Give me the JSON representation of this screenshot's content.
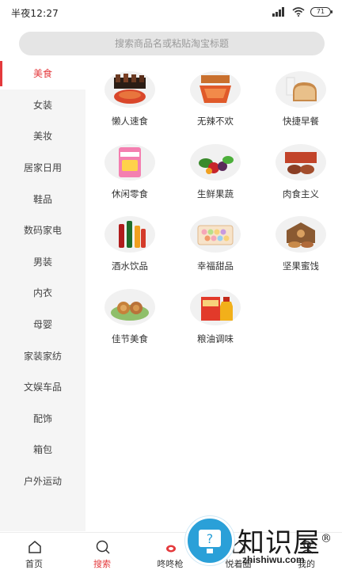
{
  "status_bar": {
    "time": "半夜12:27",
    "battery": "71"
  },
  "search": {
    "placeholder": "搜索商品名或粘贴淘宝标题"
  },
  "sidebar": {
    "items": [
      {
        "label": "美食",
        "active": true
      },
      {
        "label": "女装",
        "active": false
      },
      {
        "label": "美妆",
        "active": false
      },
      {
        "label": "居家日用",
        "active": false
      },
      {
        "label": "鞋品",
        "active": false
      },
      {
        "label": "数码家电",
        "active": false
      },
      {
        "label": "男装",
        "active": false
      },
      {
        "label": "内衣",
        "active": false
      },
      {
        "label": "母婴",
        "active": false
      },
      {
        "label": "家装家纺",
        "active": false
      },
      {
        "label": "文娱车品",
        "active": false
      },
      {
        "label": "配饰",
        "active": false
      },
      {
        "label": "箱包",
        "active": false
      },
      {
        "label": "户外运动",
        "active": false
      }
    ]
  },
  "categories": [
    {
      "label": "懒人速食",
      "icon": "instant-food-image"
    },
    {
      "label": "无辣不欢",
      "icon": "spicy-snack-image"
    },
    {
      "label": "快捷早餐",
      "icon": "breakfast-image"
    },
    {
      "label": "休闲零食",
      "icon": "snack-image"
    },
    {
      "label": "生鲜果蔬",
      "icon": "fresh-produce-image"
    },
    {
      "label": "肉食主义",
      "icon": "meat-image"
    },
    {
      "label": "酒水饮品",
      "icon": "drinks-image"
    },
    {
      "label": "幸福甜品",
      "icon": "dessert-image"
    },
    {
      "label": "坚果蜜饯",
      "icon": "nuts-image"
    },
    {
      "label": "佳节美食",
      "icon": "festival-food-image"
    },
    {
      "label": "粮油调味",
      "icon": "grain-oil-image"
    }
  ],
  "bottom_nav": {
    "tabs": [
      {
        "label": "首页",
        "icon": "home-icon"
      },
      {
        "label": "搜索",
        "icon": "search-icon",
        "active": true
      },
      {
        "label": "咚咚枪",
        "icon": "flash-icon"
      },
      {
        "label": "悦着圈",
        "icon": "circle-icon"
      },
      {
        "label": "我的",
        "icon": "profile-icon"
      }
    ]
  },
  "watermark": {
    "text": "知识屋",
    "registered": "®",
    "url": "zhishiwu.com"
  },
  "colors": {
    "accent": "#e4393c",
    "sidebar_bg": "#f5f5f5",
    "search_bg": "#e5e5e5"
  }
}
